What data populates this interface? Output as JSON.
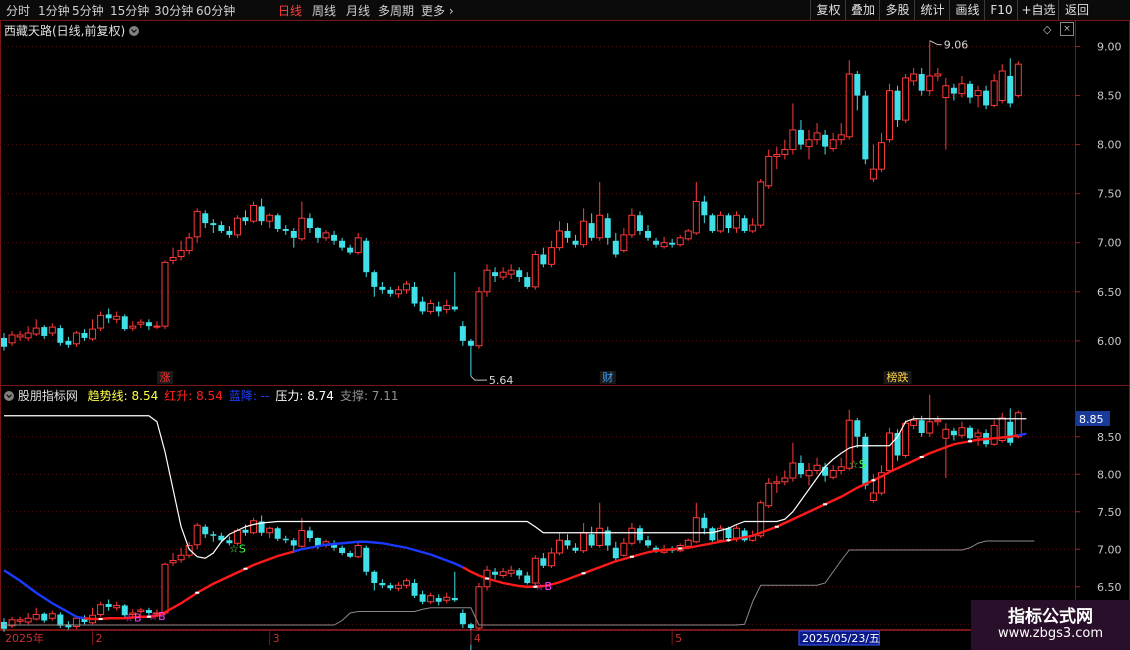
{
  "toolbar": {
    "periods": [
      "分时",
      "1分钟",
      "5分钟",
      "15分钟",
      "30分钟",
      "60分钟",
      "日线",
      "周线",
      "月线",
      "多周期",
      "更多"
    ],
    "active_period": "日线",
    "right_buttons": [
      "复权",
      "叠加",
      "多股",
      "统计",
      "画线",
      "F10",
      "+自选",
      "返回"
    ]
  },
  "main_panel": {
    "title": "西藏天路(日线,前复权)",
    "y_ticks": [
      "9.00",
      "8.50",
      "8.00",
      "7.50",
      "7.00",
      "6.50",
      "6.00"
    ],
    "high_marker": "9.06",
    "low_marker": "5.64",
    "event_tags": [
      {
        "text": "涨",
        "color": "#ff3030"
      },
      {
        "text": "财",
        "color": "#3aa0ff"
      },
      {
        "text": "榜跌",
        "color": "#ffd040"
      }
    ]
  },
  "indicator_panel": {
    "title": "股朋指标网",
    "legend": [
      {
        "label": "趋势线:",
        "value": "8.54",
        "color": "#ffff40"
      },
      {
        "label": "红升:",
        "value": "8.54",
        "color": "#ff2020"
      },
      {
        "label": "蓝降:",
        "value": "--",
        "color": "#2040ff"
      },
      {
        "label": "压力:",
        "value": "8.74",
        "color": "#ffffff"
      },
      {
        "label": "支撑:",
        "value": "7.11",
        "color": "#909090"
      }
    ],
    "y_ticks": [
      "8.50",
      "8.00",
      "7.50",
      "7.00",
      "6.50",
      "6.00"
    ],
    "current_value_badge": "8.85"
  },
  "x_axis": {
    "labels": [
      "2025年",
      "2",
      "3",
      "4",
      "5",
      "2025/05/23/五"
    ]
  },
  "watermark": {
    "line1": "指标公式网",
    "line2": "www.zbgs3.com"
  },
  "colors": {
    "up": "#ff3a3a",
    "down": "#40e0e8",
    "trend_up": "#ff1a1a",
    "trend_down": "#1a3aff",
    "pressure": "#ffffff",
    "support": "#8a8a8a"
  },
  "chart_data": {
    "type": "candlestick",
    "price_range_main": [
      5.55,
      9.25
    ],
    "price_range_indicator": [
      5.95,
      8.95
    ],
    "candles": [
      [
        6.03,
        5.94,
        6.08,
        5.9
      ],
      [
        5.98,
        6.06,
        6.1,
        5.95
      ],
      [
        6.04,
        6.06,
        6.1,
        6.0
      ],
      [
        6.03,
        6.08,
        6.15,
        6.0
      ],
      [
        6.07,
        6.13,
        6.22,
        6.05
      ],
      [
        6.14,
        6.05,
        6.16,
        6.02
      ],
      [
        6.08,
        6.14,
        6.18,
        6.05
      ],
      [
        6.13,
        5.98,
        6.16,
        5.95
      ],
      [
        6.0,
        5.96,
        6.04,
        5.93
      ],
      [
        5.97,
        6.08,
        6.1,
        5.94
      ],
      [
        6.08,
        6.03,
        6.12,
        6.0
      ],
      [
        6.02,
        6.12,
        6.22,
        6.0
      ],
      [
        6.13,
        6.26,
        6.3,
        6.1
      ],
      [
        6.27,
        6.23,
        6.33,
        6.18
      ],
      [
        6.22,
        6.25,
        6.3,
        6.18
      ],
      [
        6.25,
        6.12,
        6.27,
        6.1
      ],
      [
        6.13,
        6.15,
        6.2,
        6.1
      ],
      [
        6.17,
        6.19,
        6.22,
        6.13
      ],
      [
        6.19,
        6.15,
        6.22,
        6.11
      ],
      [
        6.15,
        6.15,
        6.2,
        6.12
      ],
      [
        6.15,
        6.8,
        6.82,
        6.12
      ],
      [
        6.82,
        6.85,
        6.95,
        6.78
      ],
      [
        6.86,
        6.92,
        7.02,
        6.82
      ],
      [
        6.92,
        7.05,
        7.1,
        6.88
      ],
      [
        7.06,
        7.32,
        7.35,
        7.0
      ],
      [
        7.3,
        7.2,
        7.33,
        7.15
      ],
      [
        7.2,
        7.18,
        7.24,
        7.1
      ],
      [
        7.18,
        7.12,
        7.22,
        7.1
      ],
      [
        7.12,
        7.08,
        7.17,
        7.05
      ],
      [
        7.08,
        7.25,
        7.28,
        7.05
      ],
      [
        7.26,
        7.22,
        7.33,
        7.18
      ],
      [
        7.22,
        7.38,
        7.42,
        7.2
      ],
      [
        7.37,
        7.22,
        7.45,
        7.18
      ],
      [
        7.22,
        7.28,
        7.3,
        7.15
      ],
      [
        7.28,
        7.14,
        7.3,
        7.11
      ],
      [
        7.14,
        7.12,
        7.18,
        7.08
      ],
      [
        7.12,
        7.05,
        7.15,
        6.95
      ],
      [
        7.04,
        7.25,
        7.42,
        7.02
      ],
      [
        7.25,
        7.15,
        7.3,
        7.1
      ],
      [
        7.15,
        7.05,
        7.16,
        7.0
      ],
      [
        7.05,
        7.1,
        7.13,
        7.02
      ],
      [
        7.08,
        7.02,
        7.12,
        6.98
      ],
      [
        7.02,
        6.95,
        7.05,
        6.92
      ],
      [
        6.95,
        6.9,
        6.98,
        6.88
      ],
      [
        6.9,
        7.05,
        7.1,
        6.88
      ],
      [
        7.02,
        6.7,
        7.05,
        6.65
      ],
      [
        6.7,
        6.55,
        6.72,
        6.45
      ],
      [
        6.55,
        6.52,
        6.6,
        6.48
      ],
      [
        6.52,
        6.48,
        6.55,
        6.45
      ],
      [
        6.48,
        6.52,
        6.56,
        6.44
      ],
      [
        6.52,
        6.58,
        6.61,
        6.48
      ],
      [
        6.55,
        6.38,
        6.6,
        6.35
      ],
      [
        6.4,
        6.3,
        6.45,
        6.27
      ],
      [
        6.3,
        6.38,
        6.42,
        6.27
      ],
      [
        6.35,
        6.3,
        6.4,
        6.25
      ],
      [
        6.32,
        6.36,
        6.42,
        6.28
      ],
      [
        6.35,
        6.32,
        6.7,
        6.3
      ],
      [
        6.15,
        6.0,
        6.2,
        5.95
      ],
      [
        6.0,
        5.95,
        6.02,
        5.64
      ],
      [
        5.95,
        6.5,
        6.55,
        5.92
      ],
      [
        6.5,
        6.72,
        6.78,
        6.45
      ],
      [
        6.7,
        6.66,
        6.75,
        6.6
      ],
      [
        6.65,
        6.7,
        6.75,
        6.62
      ],
      [
        6.68,
        6.72,
        6.78,
        6.63
      ],
      [
        6.72,
        6.65,
        6.75,
        6.6
      ],
      [
        6.65,
        6.55,
        6.7,
        6.53
      ],
      [
        6.55,
        6.88,
        6.92,
        6.52
      ],
      [
        6.88,
        6.78,
        6.95,
        6.75
      ],
      [
        6.78,
        6.95,
        7.02,
        6.75
      ],
      [
        6.95,
        7.12,
        7.22,
        6.92
      ],
      [
        7.12,
        7.05,
        7.2,
        7.0
      ],
      [
        7.02,
        6.98,
        7.08,
        6.95
      ],
      [
        6.98,
        7.22,
        7.35,
        6.95
      ],
      [
        7.2,
        7.05,
        7.3,
        7.02
      ],
      [
        7.05,
        7.28,
        7.62,
        7.02
      ],
      [
        7.25,
        7.05,
        7.3,
        6.98
      ],
      [
        7.02,
        6.88,
        7.1,
        6.85
      ],
      [
        6.92,
        7.08,
        7.15,
        6.9
      ],
      [
        7.08,
        7.28,
        7.35,
        7.05
      ],
      [
        7.28,
        7.12,
        7.32,
        7.08
      ],
      [
        7.12,
        7.05,
        7.18,
        7.02
      ],
      [
        7.02,
        6.98,
        7.05,
        6.95
      ],
      [
        6.96,
        7.0,
        7.06,
        6.94
      ],
      [
        7.0,
        6.98,
        7.04,
        6.95
      ],
      [
        6.98,
        7.05,
        7.08,
        6.96
      ],
      [
        7.04,
        7.12,
        7.14,
        7.02
      ],
      [
        7.1,
        7.42,
        7.62,
        7.08
      ],
      [
        7.42,
        7.28,
        7.48,
        7.2
      ],
      [
        7.28,
        7.12,
        7.3,
        7.1
      ],
      [
        7.12,
        7.28,
        7.32,
        7.1
      ],
      [
        7.28,
        7.15,
        7.3,
        7.1
      ],
      [
        7.15,
        7.28,
        7.32,
        7.1
      ],
      [
        7.25,
        7.12,
        7.28,
        7.1
      ],
      [
        7.12,
        7.18,
        7.25,
        7.1
      ],
      [
        7.18,
        7.62,
        7.65,
        7.15
      ],
      [
        7.58,
        7.88,
        7.95,
        7.55
      ],
      [
        7.88,
        7.9,
        7.98,
        7.75
      ],
      [
        7.9,
        7.95,
        8.05,
        7.85
      ],
      [
        7.95,
        8.15,
        8.42,
        7.9
      ],
      [
        8.15,
        8.0,
        8.25,
        7.95
      ],
      [
        7.98,
        8.05,
        8.15,
        7.85
      ],
      [
        8.05,
        8.12,
        8.22,
        8.0
      ],
      [
        8.1,
        7.98,
        8.15,
        7.9
      ],
      [
        7.96,
        8.05,
        8.12,
        7.93
      ],
      [
        8.05,
        8.1,
        8.22,
        8.0
      ],
      [
        8.08,
        8.72,
        8.86,
        8.05
      ],
      [
        8.72,
        8.5,
        8.75,
        8.35
      ],
      [
        8.5,
        7.85,
        8.55,
        7.8
      ],
      [
        7.65,
        7.75,
        8.0,
        7.62
      ],
      [
        7.75,
        8.02,
        8.12,
        7.72
      ],
      [
        8.05,
        8.55,
        8.62,
        8.02
      ],
      [
        8.55,
        8.25,
        8.6,
        8.18
      ],
      [
        8.25,
        8.68,
        8.72,
        8.22
      ],
      [
        8.65,
        8.72,
        8.78,
        8.6
      ],
      [
        8.72,
        8.55,
        8.78,
        8.5
      ],
      [
        8.55,
        8.7,
        9.06,
        8.5
      ],
      [
        8.7,
        8.72,
        8.78,
        8.65
      ],
      [
        8.48,
        8.6,
        8.68,
        7.95
      ],
      [
        8.58,
        8.52,
        8.62,
        8.45
      ],
      [
        8.52,
        8.62,
        8.7,
        8.48
      ],
      [
        8.62,
        8.48,
        8.65,
        8.42
      ],
      [
        8.5,
        8.55,
        8.6,
        8.38
      ],
      [
        8.55,
        8.4,
        8.6,
        8.36
      ],
      [
        8.4,
        8.65,
        8.72,
        8.38
      ],
      [
        8.45,
        8.75,
        8.82,
        8.42
      ],
      [
        8.7,
        8.42,
        8.88,
        8.38
      ],
      [
        8.5,
        8.82,
        8.85,
        8.48
      ]
    ],
    "trend_line": [
      6.72,
      6.65,
      6.58,
      6.5,
      6.42,
      6.35,
      6.28,
      6.22,
      6.16,
      6.1,
      6.08,
      6.07,
      6.07,
      6.08,
      6.08,
      6.08,
      6.09,
      6.1,
      6.1,
      6.11,
      6.16,
      6.22,
      6.28,
      6.35,
      6.42,
      6.48,
      6.54,
      6.59,
      6.64,
      6.69,
      6.74,
      6.79,
      6.83,
      6.87,
      6.91,
      6.94,
      6.97,
      7.0,
      7.02,
      7.04,
      7.06,
      7.07,
      7.08,
      7.09,
      7.1,
      7.1,
      7.09,
      7.08,
      7.06,
      7.04,
      7.02,
      6.99,
      6.96,
      6.93,
      6.89,
      6.85,
      6.81,
      6.76,
      6.7,
      6.65,
      6.61,
      6.58,
      6.55,
      6.53,
      6.51,
      6.5,
      6.5,
      6.51,
      6.53,
      6.56,
      6.6,
      6.64,
      6.68,
      6.72,
      6.76,
      6.8,
      6.84,
      6.87,
      6.9,
      6.93,
      6.96,
      6.98,
      6.99,
      7.0,
      7.01,
      7.02,
      7.04,
      7.06,
      7.08,
      7.1,
      7.12,
      7.14,
      7.16,
      7.18,
      7.22,
      7.26,
      7.3,
      7.35,
      7.4,
      7.45,
      7.5,
      7.55,
      7.6,
      7.65,
      7.7,
      7.76,
      7.82,
      7.87,
      7.92,
      7.97,
      8.03,
      8.08,
      8.13,
      8.18,
      8.23,
      8.28,
      8.32,
      8.36,
      8.4,
      8.42,
      8.44,
      8.46,
      8.47,
      8.48,
      8.49,
      8.5,
      8.52,
      8.54
    ],
    "trend_up_segments": [
      [
        10,
        35
      ],
      [
        57,
        125
      ]
    ],
    "pressure_line": [
      8.78,
      8.78,
      8.78,
      8.78,
      8.78,
      8.78,
      8.78,
      8.78,
      8.78,
      8.78,
      8.78,
      8.78,
      8.78,
      8.78,
      8.78,
      8.78,
      8.78,
      8.78,
      8.78,
      8.7,
      8.3,
      7.8,
      7.3,
      7.0,
      6.9,
      6.88,
      6.95,
      7.1,
      7.2,
      7.25,
      7.3,
      7.33,
      7.35,
      7.36,
      7.37,
      7.37,
      7.37,
      7.37,
      7.37,
      7.37,
      7.37,
      7.37,
      7.37,
      7.37,
      7.37,
      7.37,
      7.37,
      7.37,
      7.37,
      7.37,
      7.37,
      7.37,
      7.37,
      7.37,
      7.37,
      7.37,
      7.37,
      7.37,
      7.37,
      7.37,
      7.37,
      7.37,
      7.37,
      7.37,
      7.37,
      7.37,
      7.3,
      7.22,
      7.22,
      7.22,
      7.22,
      7.22,
      7.22,
      7.22,
      7.22,
      7.22,
      7.22,
      7.22,
      7.22,
      7.22,
      7.22,
      7.22,
      7.22,
      7.22,
      7.22,
      7.22,
      7.22,
      7.22,
      7.22,
      7.25,
      7.28,
      7.33,
      7.37,
      7.37,
      7.37,
      7.37,
      7.37,
      7.4,
      7.5,
      7.65,
      7.8,
      7.95,
      8.1,
      8.2,
      8.28,
      8.35,
      8.38,
      8.38,
      8.38,
      8.38,
      8.38,
      8.5,
      8.7,
      8.74,
      8.74,
      8.74,
      8.74,
      8.74,
      8.74,
      8.74,
      8.74,
      8.74,
      8.74,
      8.74,
      8.74,
      8.74,
      8.74,
      8.74
    ],
    "support_line": [
      5.99,
      5.99,
      5.99,
      5.99,
      5.99,
      5.99,
      5.99,
      5.99,
      5.99,
      5.99,
      5.99,
      5.99,
      5.99,
      5.99,
      5.99,
      5.99,
      5.99,
      5.99,
      5.99,
      5.99,
      5.99,
      5.99,
      5.99,
      5.99,
      5.99,
      5.99,
      5.99,
      5.99,
      5.99,
      5.99,
      5.99,
      5.99,
      5.99,
      5.99,
      5.99,
      5.99,
      5.99,
      5.99,
      5.99,
      5.99,
      5.99,
      5.99,
      6.05,
      6.15,
      6.17,
      6.17,
      6.17,
      6.17,
      6.17,
      6.17,
      6.17,
      6.17,
      6.2,
      6.22,
      6.22,
      6.22,
      6.22,
      6.22,
      6.22,
      5.99,
      5.99,
      5.99,
      5.99,
      5.99,
      5.99,
      5.99,
      5.99,
      5.99,
      5.99,
      5.99,
      5.99,
      5.99,
      5.99,
      5.99,
      5.99,
      5.99,
      5.99,
      5.99,
      5.99,
      5.99,
      5.99,
      5.99,
      5.99,
      5.99,
      5.99,
      5.99,
      5.99,
      5.99,
      5.99,
      5.99,
      5.99,
      5.99,
      6.0,
      6.3,
      6.52,
      6.52,
      6.52,
      6.52,
      6.52,
      6.52,
      6.52,
      6.52,
      6.55,
      6.7,
      6.85,
      6.99,
      6.99,
      6.99,
      6.99,
      6.99,
      6.99,
      6.99,
      6.99,
      6.99,
      6.99,
      6.99,
      6.99,
      6.99,
      6.99,
      6.99,
      7.02,
      7.08,
      7.11,
      7.11,
      7.11,
      7.11,
      7.11,
      7.11,
      7.11
    ],
    "signals": [
      {
        "index": 16,
        "text": "☆B",
        "color": "#ff40ff"
      },
      {
        "index": 19,
        "text": "☆B",
        "color": "#ff40ff"
      },
      {
        "index": 29,
        "text": "☆S",
        "color": "#40ff40"
      },
      {
        "index": 67,
        "text": "☆B",
        "color": "#ff40ff"
      },
      {
        "index": 106,
        "text": "☆S",
        "color": "#40ff40"
      }
    ],
    "x_label_indices": [
      0,
      11,
      33,
      58,
      83,
      99
    ]
  }
}
